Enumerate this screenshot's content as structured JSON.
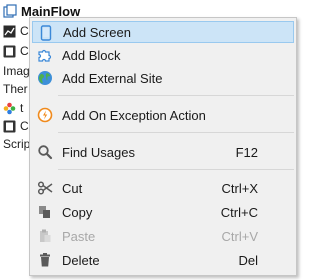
{
  "tree": {
    "root_label": "MainFlow",
    "rows": [
      "C",
      "C",
      "Imag",
      "Ther",
      "t",
      "C",
      "Scrip"
    ]
  },
  "menu": {
    "items": [
      {
        "label": "Add Screen",
        "shortcut": "",
        "icon": "screen-icon",
        "highlighted": true,
        "enabled": true
      },
      {
        "label": "Add Block",
        "shortcut": "",
        "icon": "block-puzzle-icon",
        "enabled": true
      },
      {
        "label": "Add External Site",
        "shortcut": "",
        "icon": "globe-icon",
        "enabled": true
      },
      {
        "label": "Add On Exception Action",
        "shortcut": "",
        "icon": "exception-icon",
        "enabled": true
      },
      {
        "label": "Find Usages",
        "shortcut": "F12",
        "icon": "search-icon",
        "enabled": true
      },
      {
        "label": "Cut",
        "shortcut": "Ctrl+X",
        "icon": "scissors-icon",
        "enabled": true
      },
      {
        "label": "Copy",
        "shortcut": "Ctrl+C",
        "icon": "copy-icon",
        "enabled": true
      },
      {
        "label": "Paste",
        "shortcut": "Ctrl+V",
        "icon": "paste-icon",
        "enabled": false
      },
      {
        "label": "Delete",
        "shortcut": "Del",
        "icon": "trash-icon",
        "enabled": true
      }
    ]
  },
  "colors": {
    "highlight_bg": "#cce4f7",
    "highlight_border": "#99c9ef",
    "menu_bg": "#f0f0f0",
    "disabled_text": "#a8a8a8"
  }
}
